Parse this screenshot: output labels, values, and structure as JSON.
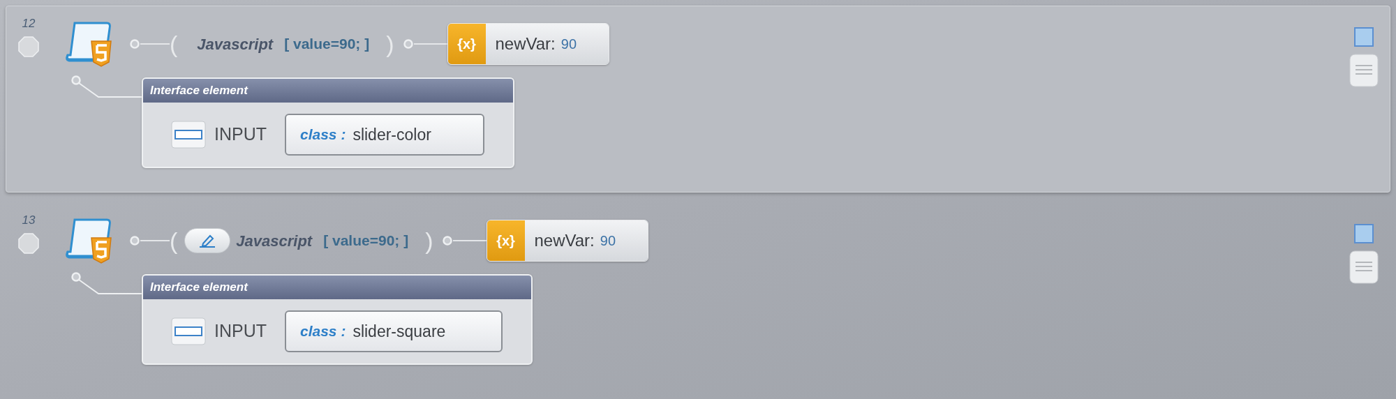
{
  "steps": [
    {
      "number": "12",
      "selected": true,
      "edit_button": false,
      "open_paren": "(",
      "language": "Javascript",
      "code": "[ value=90; ]",
      "close_paren": ")",
      "variable": {
        "icon": "{x}",
        "name": "newVar:",
        "value": "90"
      },
      "element": {
        "header": "Interface element",
        "tag": "INPUT",
        "attr_name": "class :",
        "attr_value": "slider-color"
      }
    },
    {
      "number": "13",
      "selected": false,
      "edit_button": true,
      "open_paren": "(",
      "language": "Javascript",
      "code": "[ value=90; ]",
      "close_paren": ")",
      "variable": {
        "icon": "{x}",
        "name": "newVar:",
        "value": "90"
      },
      "element": {
        "header": "Interface element",
        "tag": "INPUT",
        "attr_name": "class :",
        "attr_value": "slider-square"
      }
    }
  ]
}
